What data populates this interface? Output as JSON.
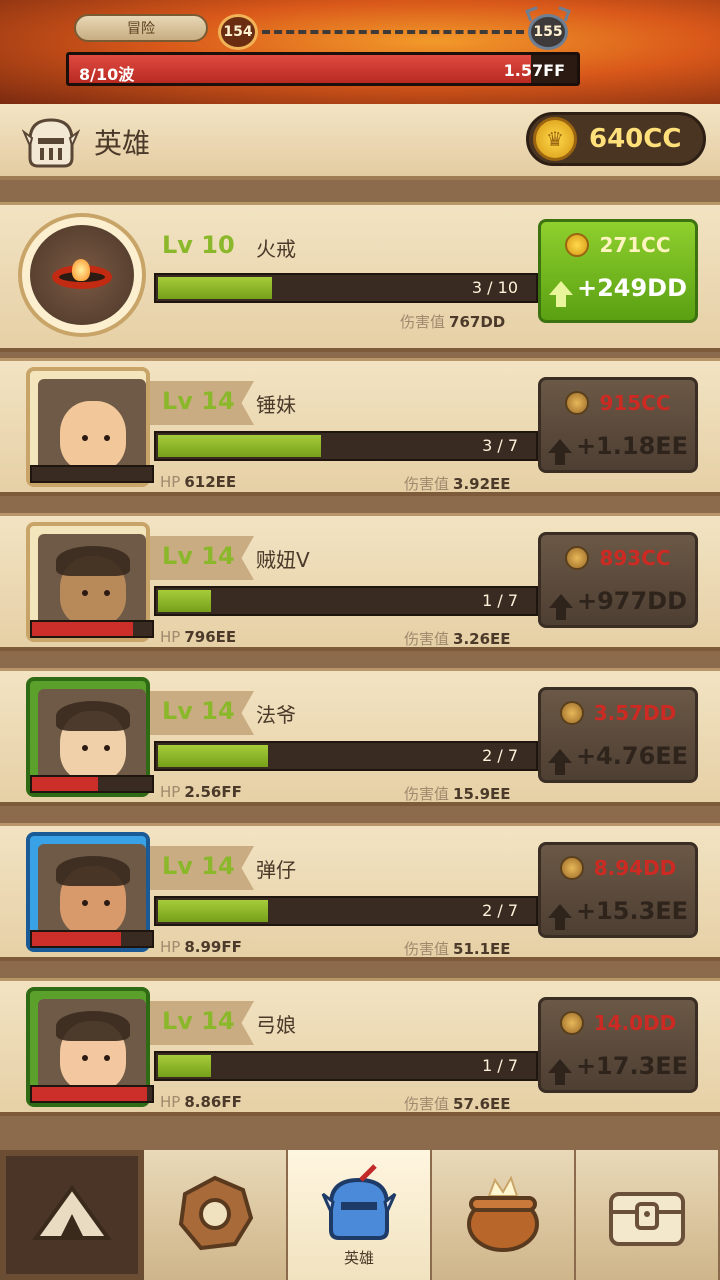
{
  "top_bar": {
    "mode_label": "冒险",
    "current_level": "154",
    "next_level": "155",
    "wave_text": "8/10波",
    "wave_progress": 0.91,
    "boss_hp": "1.57FF"
  },
  "hero_header": {
    "title": "英雄",
    "gold": "640CC",
    "icon": "knight-helmet-icon"
  },
  "labels": {
    "lv": "Lv",
    "hp": "HP",
    "damage": "伤害值"
  },
  "item_card": {
    "level": "10",
    "name": "火戒",
    "xp_text": "3 / 10",
    "xp_ratio": 0.3,
    "damage": "767DD",
    "cost": "271CC",
    "gain": "+249DD",
    "affordable": true,
    "icon": "fire-ring-icon"
  },
  "heroes": [
    {
      "level": "14",
      "name": "锤妹",
      "xp_text": "3 / 7",
      "xp_ratio": 0.43,
      "hp": "612EE",
      "damage": "3.92EE",
      "hp_ratio": 0.0,
      "cost": "915CC",
      "gain": "+1.18EE",
      "frame": "gold",
      "icon": "hammer-girl-portrait"
    },
    {
      "level": "14",
      "name": "贼妞V",
      "xp_text": "1 / 7",
      "xp_ratio": 0.14,
      "hp": "796EE",
      "damage": "3.26EE",
      "hp_ratio": 0.84,
      "cost": "893CC",
      "gain": "+977DD",
      "frame": "gold",
      "icon": "thief-girl-portrait"
    },
    {
      "level": "14",
      "name": "法爷",
      "xp_text": "2 / 7",
      "xp_ratio": 0.29,
      "hp": "2.56FF",
      "damage": "15.9EE",
      "hp_ratio": 0.55,
      "cost": "3.57DD",
      "gain": "+4.76EE",
      "frame": "green",
      "icon": "wizard-grandpa-portrait"
    },
    {
      "level": "14",
      "name": "弹仔",
      "xp_text": "2 / 7",
      "xp_ratio": 0.29,
      "hp": "8.99FF",
      "damage": "51.1EE",
      "hp_ratio": 0.74,
      "cost": "8.94DD",
      "gain": "+15.3EE",
      "frame": "blue",
      "icon": "slingshot-boy-portrait"
    },
    {
      "level": "14",
      "name": "弓娘",
      "xp_text": "1 / 7",
      "xp_ratio": 0.14,
      "hp": "8.86FF",
      "damage": "57.6EE",
      "hp_ratio": 0.96,
      "cost": "14.0DD",
      "gain": "+17.3EE",
      "frame": "green",
      "icon": "archer-girl-portrait"
    }
  ],
  "nav": {
    "tabs": [
      {
        "icon": "camp-tent-icon",
        "label": ""
      },
      {
        "icon": "stone-gear-icon",
        "label": ""
      },
      {
        "icon": "knight-helmet-icon",
        "label": "英雄"
      },
      {
        "icon": "cauldron-icon",
        "label": ""
      },
      {
        "icon": "treasure-chest-icon",
        "label": ""
      }
    ],
    "selected_index": 2
  },
  "colors": {
    "xp_green": "#8ab82a",
    "cost_red": "#cc2a22",
    "hp_red": "#cc2f2a",
    "gold": "#ffe07a"
  }
}
